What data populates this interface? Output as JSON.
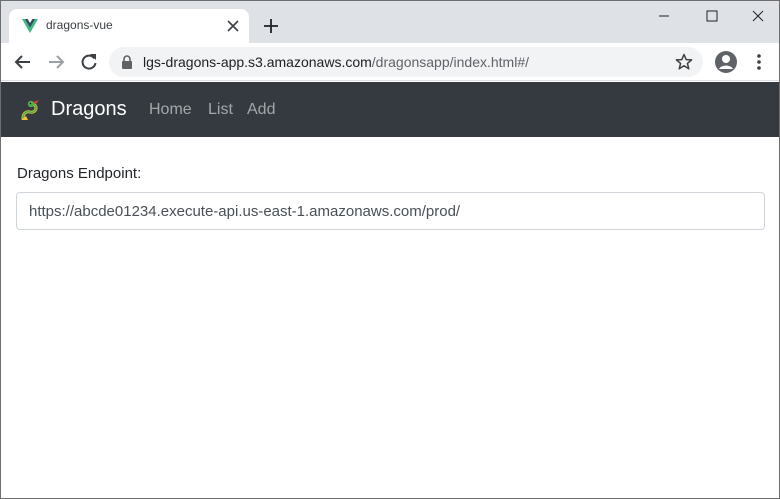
{
  "browser": {
    "tab_title": "dragons-vue",
    "url_host": "lgs-dragons-app.s3.amazonaws.com",
    "url_path": "/dragonsapp/index.html#/"
  },
  "navbar": {
    "brand": "Dragons",
    "links": [
      "Home",
      "List",
      "Add"
    ]
  },
  "form": {
    "label": "Dragons Endpoint:",
    "endpoint_value": "https://abcde01234.execute-api.us-east-1.amazonaws.com/prod/"
  },
  "icons": {
    "favicon": "vue-logo-icon",
    "brand": "dragon-icon"
  },
  "colors": {
    "navbar_bg": "#343a40",
    "tabstrip_bg": "#dee1e6",
    "vue_green": "#41b883",
    "vue_dark": "#35495e"
  }
}
